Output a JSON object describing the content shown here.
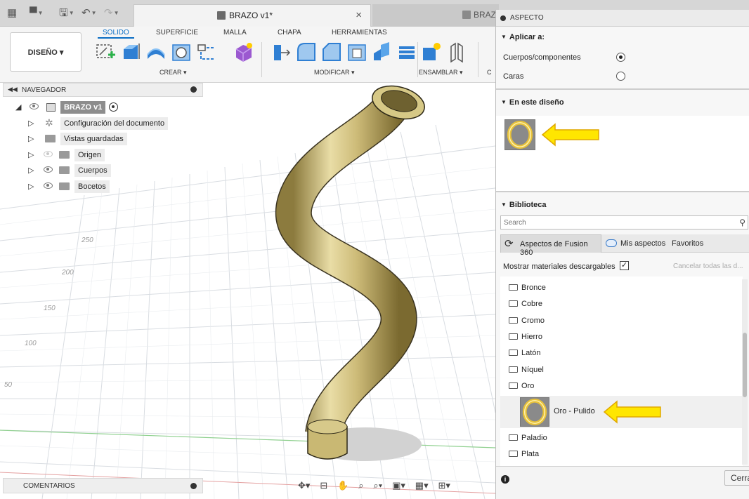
{
  "tabs": {
    "active_title": "BRAZO v1*",
    "second_title": "BRAZO"
  },
  "toolbar": {
    "design_label": "DISEÑO ▾",
    "tabs": [
      "SOLIDO",
      "SUPERFICIE",
      "MALLA",
      "CHAPA",
      "HERRAMIENTAS"
    ],
    "groups": {
      "crear": "CREAR ▾",
      "modificar": "MODIFICAR ▾",
      "ensamblar": "ENSAMBLAR ▾",
      "cut": "C"
    }
  },
  "navigator": {
    "title": "NAVEGADOR",
    "root": "BRAZO v1",
    "items": [
      {
        "label": "Configuración del documento",
        "icon": "gear-icon"
      },
      {
        "label": "Vistas guardadas",
        "icon": "folder-icon"
      },
      {
        "label": "Origen",
        "icon": "folder-icon"
      },
      {
        "label": "Cuerpos",
        "icon": "folder-icon"
      },
      {
        "label": "Bocetos",
        "icon": "folder-icon"
      }
    ]
  },
  "viewport": {
    "grid_labels": [
      "250",
      "200",
      "150",
      "100",
      "50"
    ]
  },
  "comments": {
    "label": "COMENTARIOS"
  },
  "panel": {
    "title": "ASPECTO",
    "apply_to": {
      "heading": "Aplicar a:",
      "options": [
        {
          "label": "Cuerpos/componentes",
          "selected": true
        },
        {
          "label": "Caras",
          "selected": false
        }
      ]
    },
    "in_design": {
      "heading": "En este diseño"
    },
    "library": {
      "heading": "Biblioteca",
      "search_placeholder": "Search",
      "tabs": [
        "Aspectos de Fusion 360",
        "Mis aspectos",
        "Favoritos"
      ],
      "show_downloadable": "Mostrar materiales descargables",
      "show_downloadable_checked": true,
      "cancel_all": "Cancelar todas las d...",
      "folders": [
        "Bronce",
        "Cobre",
        "Cromo",
        "Hierro",
        "Latón",
        "Níquel",
        "Oro",
        "Paladio",
        "Plata"
      ],
      "selected_material": "Oro - Pulido"
    },
    "close_label": "Cerra"
  },
  "colors": {
    "accent_blue": "#0a6dc4",
    "gold": "#d8c98c",
    "highlight_yellow": "#ffe600",
    "arrow_outline": "#e0a800"
  }
}
